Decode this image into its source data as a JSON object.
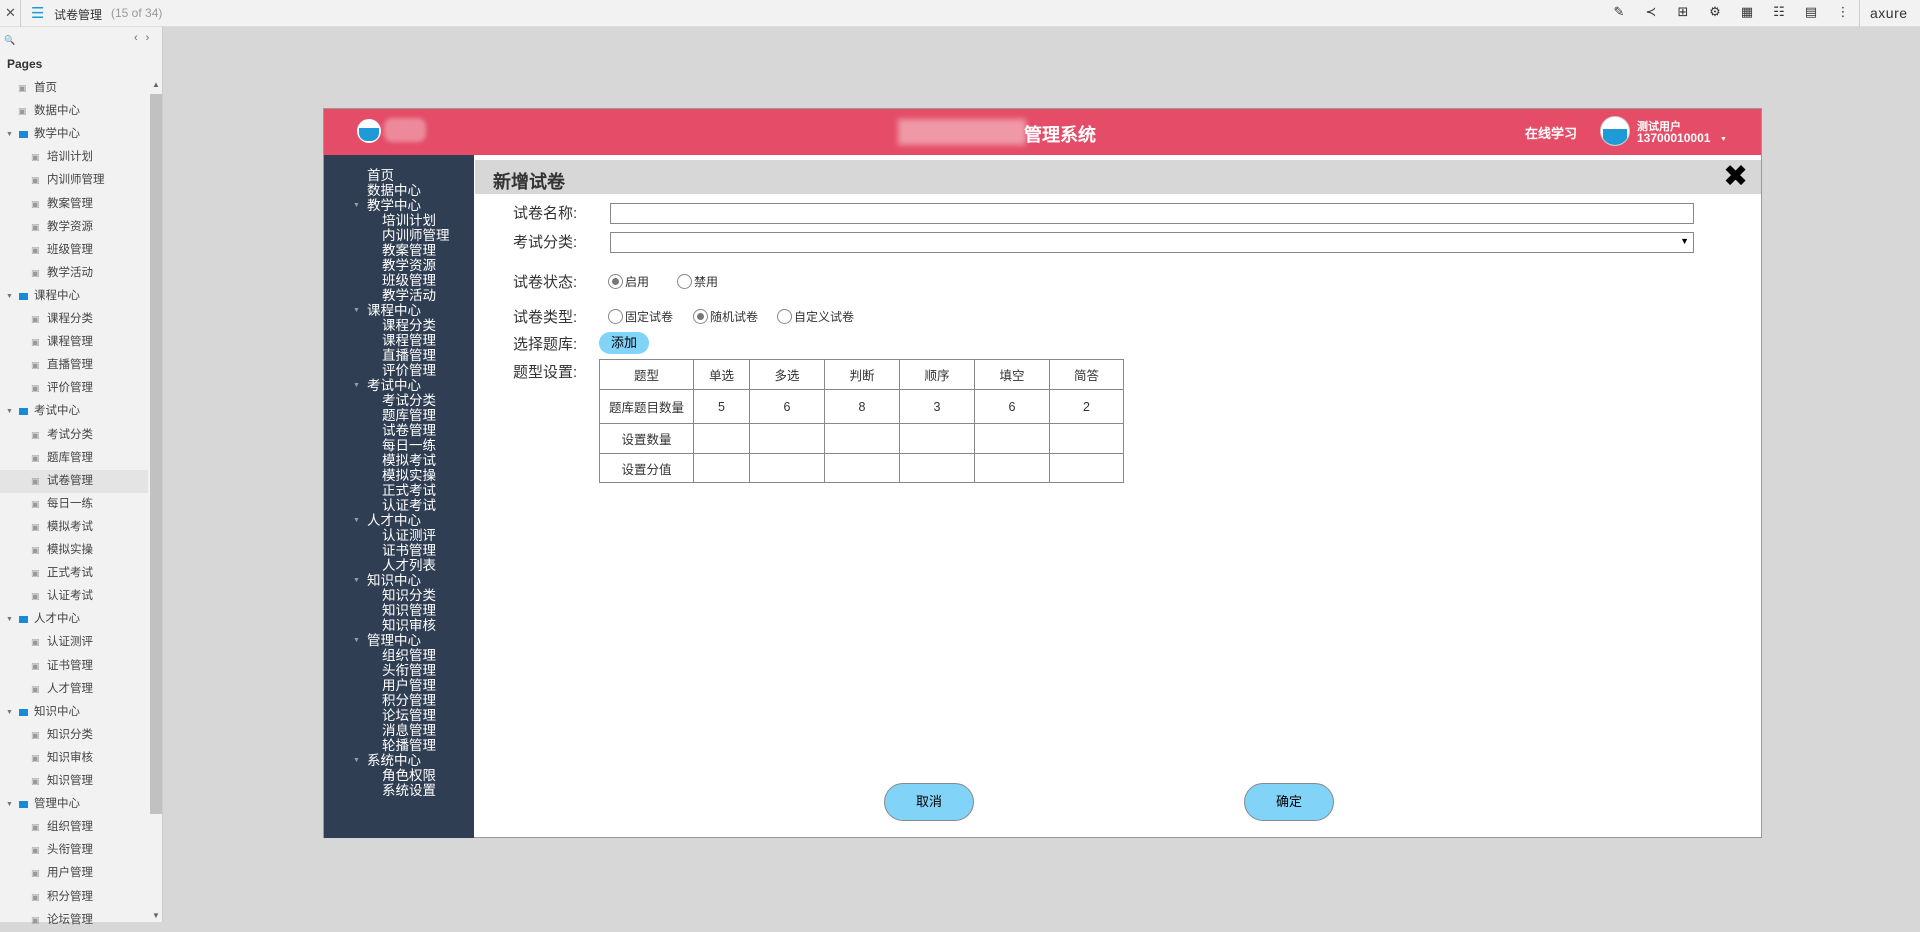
{
  "topbar": {
    "title": "试卷管理",
    "count": "(15 of 34)",
    "brand": "axure",
    "icons": [
      "edit-icon",
      "share-icon",
      "map-icon",
      "settings-icon",
      "grid-icon",
      "list-icon",
      "notes-icon",
      "more-icon"
    ]
  },
  "panel": {
    "heading": "Pages",
    "items": [
      {
        "label": "首页",
        "level": 1,
        "type": "page"
      },
      {
        "label": "数据中心",
        "level": 1,
        "type": "page"
      },
      {
        "label": "教学中心",
        "level": 0,
        "type": "folder"
      },
      {
        "label": "培训计划",
        "level": 2,
        "type": "page"
      },
      {
        "label": "内训师管理",
        "level": 2,
        "type": "page"
      },
      {
        "label": "教案管理",
        "level": 2,
        "type": "page"
      },
      {
        "label": "教学资源",
        "level": 2,
        "type": "page"
      },
      {
        "label": "班级管理",
        "level": 2,
        "type": "page"
      },
      {
        "label": "教学活动",
        "level": 2,
        "type": "page"
      },
      {
        "label": "课程中心",
        "level": 0,
        "type": "folder"
      },
      {
        "label": "课程分类",
        "level": 2,
        "type": "page"
      },
      {
        "label": "课程管理",
        "level": 2,
        "type": "page"
      },
      {
        "label": "直播管理",
        "level": 2,
        "type": "page"
      },
      {
        "label": "评价管理",
        "level": 2,
        "type": "page"
      },
      {
        "label": "考试中心",
        "level": 0,
        "type": "folder"
      },
      {
        "label": "考试分类",
        "level": 2,
        "type": "page"
      },
      {
        "label": "题库管理",
        "level": 2,
        "type": "page"
      },
      {
        "label": "试卷管理",
        "level": 2,
        "type": "page",
        "selected": true
      },
      {
        "label": "每日一练",
        "level": 2,
        "type": "page"
      },
      {
        "label": "模拟考试",
        "level": 2,
        "type": "page"
      },
      {
        "label": "模拟实操",
        "level": 2,
        "type": "page"
      },
      {
        "label": "正式考试",
        "level": 2,
        "type": "page"
      },
      {
        "label": "认证考试",
        "level": 2,
        "type": "page"
      },
      {
        "label": "人才中心",
        "level": 0,
        "type": "folder"
      },
      {
        "label": "认证测评",
        "level": 2,
        "type": "page"
      },
      {
        "label": "证书管理",
        "level": 2,
        "type": "page"
      },
      {
        "label": "人才管理",
        "level": 2,
        "type": "page"
      },
      {
        "label": "知识中心",
        "level": 0,
        "type": "folder"
      },
      {
        "label": "知识分类",
        "level": 2,
        "type": "page"
      },
      {
        "label": "知识审核",
        "level": 2,
        "type": "page"
      },
      {
        "label": "知识管理",
        "level": 2,
        "type": "page"
      },
      {
        "label": "管理中心",
        "level": 0,
        "type": "folder"
      },
      {
        "label": "组织管理",
        "level": 2,
        "type": "page"
      },
      {
        "label": "头衔管理",
        "level": 2,
        "type": "page"
      },
      {
        "label": "用户管理",
        "level": 2,
        "type": "page"
      },
      {
        "label": "积分管理",
        "level": 2,
        "type": "page"
      },
      {
        "label": "论坛管理",
        "level": 2,
        "type": "page"
      }
    ]
  },
  "header": {
    "title_visible": "管理系统",
    "online": "在线学习",
    "user_name": "测试用户",
    "user_phone": "13700010001"
  },
  "sidenav": [
    {
      "label": "首页",
      "level": 0
    },
    {
      "label": "数据中心",
      "level": 0
    },
    {
      "label": "教学中心",
      "level": 0,
      "group": true
    },
    {
      "label": "培训计划",
      "level": 1
    },
    {
      "label": "内训师管理",
      "level": 1
    },
    {
      "label": "教案管理",
      "level": 1
    },
    {
      "label": "教学资源",
      "level": 1
    },
    {
      "label": "班级管理",
      "level": 1
    },
    {
      "label": "教学活动",
      "level": 1
    },
    {
      "label": "课程中心",
      "level": 0,
      "group": true
    },
    {
      "label": "课程分类",
      "level": 1
    },
    {
      "label": "课程管理",
      "level": 1
    },
    {
      "label": "直播管理",
      "level": 1
    },
    {
      "label": "评价管理",
      "level": 1
    },
    {
      "label": "考试中心",
      "level": 0,
      "group": true
    },
    {
      "label": "考试分类",
      "level": 1
    },
    {
      "label": "题库管理",
      "level": 1
    },
    {
      "label": "试卷管理",
      "level": 1
    },
    {
      "label": "每日一练",
      "level": 1
    },
    {
      "label": "模拟考试",
      "level": 1
    },
    {
      "label": "模拟实操",
      "level": 1
    },
    {
      "label": "正式考试",
      "level": 1
    },
    {
      "label": "认证考试",
      "level": 1
    },
    {
      "label": "人才中心",
      "level": 0,
      "group": true
    },
    {
      "label": "认证测评",
      "level": 1
    },
    {
      "label": "证书管理",
      "level": 1
    },
    {
      "label": "人才列表",
      "level": 1
    },
    {
      "label": "知识中心",
      "level": 0,
      "group": true
    },
    {
      "label": "知识分类",
      "level": 1
    },
    {
      "label": "知识管理",
      "level": 1
    },
    {
      "label": "知识审核",
      "level": 1
    },
    {
      "label": "管理中心",
      "level": 0,
      "group": true
    },
    {
      "label": "组织管理",
      "level": 1
    },
    {
      "label": "头衔管理",
      "level": 1
    },
    {
      "label": "用户管理",
      "level": 1
    },
    {
      "label": "积分管理",
      "level": 1
    },
    {
      "label": "论坛管理",
      "level": 1
    },
    {
      "label": "消息管理",
      "level": 1
    },
    {
      "label": "轮播管理",
      "level": 1
    },
    {
      "label": "系统中心",
      "level": 0,
      "group": true
    },
    {
      "label": "角色权限",
      "level": 1
    },
    {
      "label": "系统设置",
      "level": 1
    }
  ],
  "form": {
    "title": "新增试卷",
    "name_label": "试卷名称:",
    "name_value": "",
    "category_label": "考试分类:",
    "category_value": "",
    "status_label": "试卷状态:",
    "status_options": [
      "启用",
      "禁用"
    ],
    "status_selected": "启用",
    "type_label": "试卷类型:",
    "type_options": [
      "固定试卷",
      "随机试卷",
      "自定义试卷"
    ],
    "type_selected": "随机试卷",
    "bank_label": "选择题库:",
    "add_label": "添加",
    "table_label": "题型设置:",
    "table": {
      "headers": [
        "题型",
        "单选",
        "多选",
        "判断",
        "顺序",
        "填空",
        "简答"
      ],
      "rows": [
        [
          "题库题目数量",
          "5",
          "6",
          "8",
          "3",
          "6",
          "2"
        ],
        [
          "设置数量",
          "",
          "",
          "",
          "",
          "",
          ""
        ],
        [
          "设置分值",
          "",
          "",
          "",
          "",
          "",
          ""
        ]
      ]
    },
    "cancel": "取消",
    "confirm": "确定"
  }
}
